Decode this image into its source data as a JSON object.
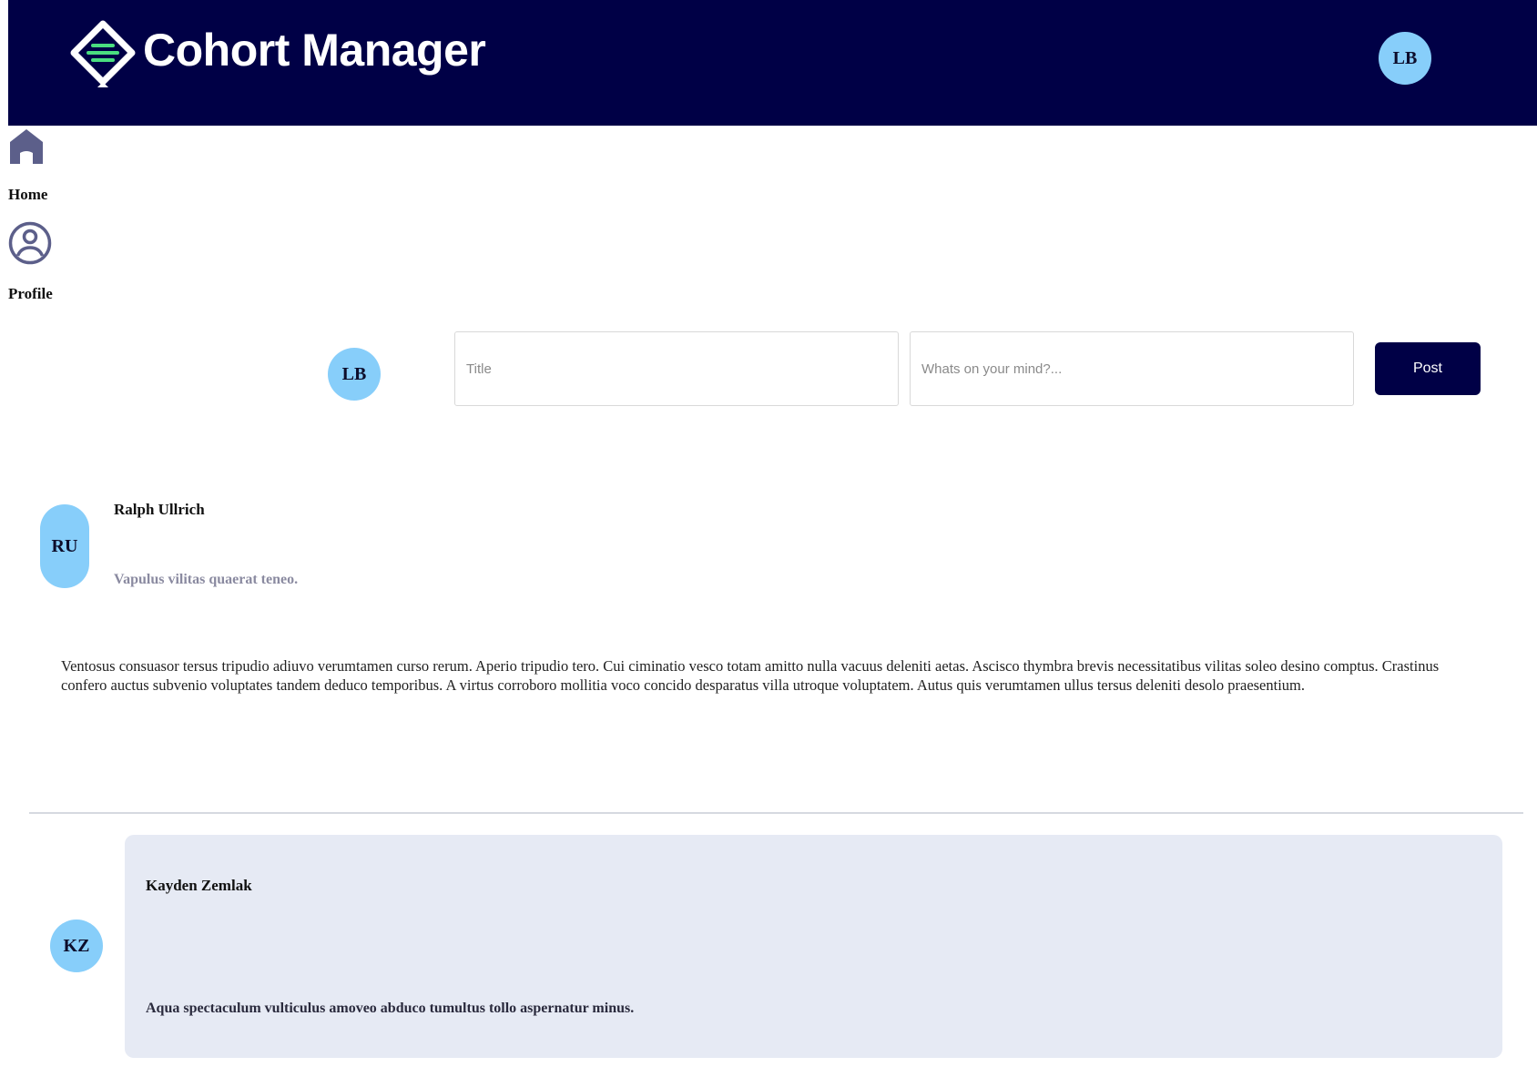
{
  "header": {
    "app_title": "Cohort Manager",
    "user_initials": "LB",
    "brand_color": "#000046",
    "logo_icon": "diamond-logo-icon"
  },
  "sidebar": {
    "items": [
      {
        "label": "Home",
        "icon": "home-icon"
      },
      {
        "label": "Profile",
        "icon": "profile-icon"
      }
    ]
  },
  "composer": {
    "user_initials": "LB",
    "title_placeholder": "Title",
    "body_placeholder": "Whats on your mind?...",
    "post_label": "Post"
  },
  "posts": [
    {
      "initials": "RU",
      "author": "Ralph Ullrich",
      "title": "Vapulus vilitas quaerat teneo.",
      "body": "Ventosus consuasor tersus tripudio adiuvo verumtamen curso rerum. Aperio tripudio tero. Cui ciminatio vesco totam amitto nulla vacuus deleniti aetas. Ascisco thymbra brevis necessitatibus vilitas soleo desino comptus. Crastinus confero auctus subvenio voluptates tandem deduco temporibus. A virtus corroboro mollitia voco concido desparatus villa utroque voluptatem. Autus quis verumtamen ullus tersus deleniti desolo praesentium."
    },
    {
      "initials": "KZ",
      "author": "Kayden Zemlak",
      "title": "Aqua spectaculum vulticulus amoveo abduco tumultus tollo aspernatur minus."
    }
  ],
  "colors": {
    "avatar": "#87cefa",
    "card_background": "#e6eaf4",
    "muted_title": "#8a8aa0"
  }
}
